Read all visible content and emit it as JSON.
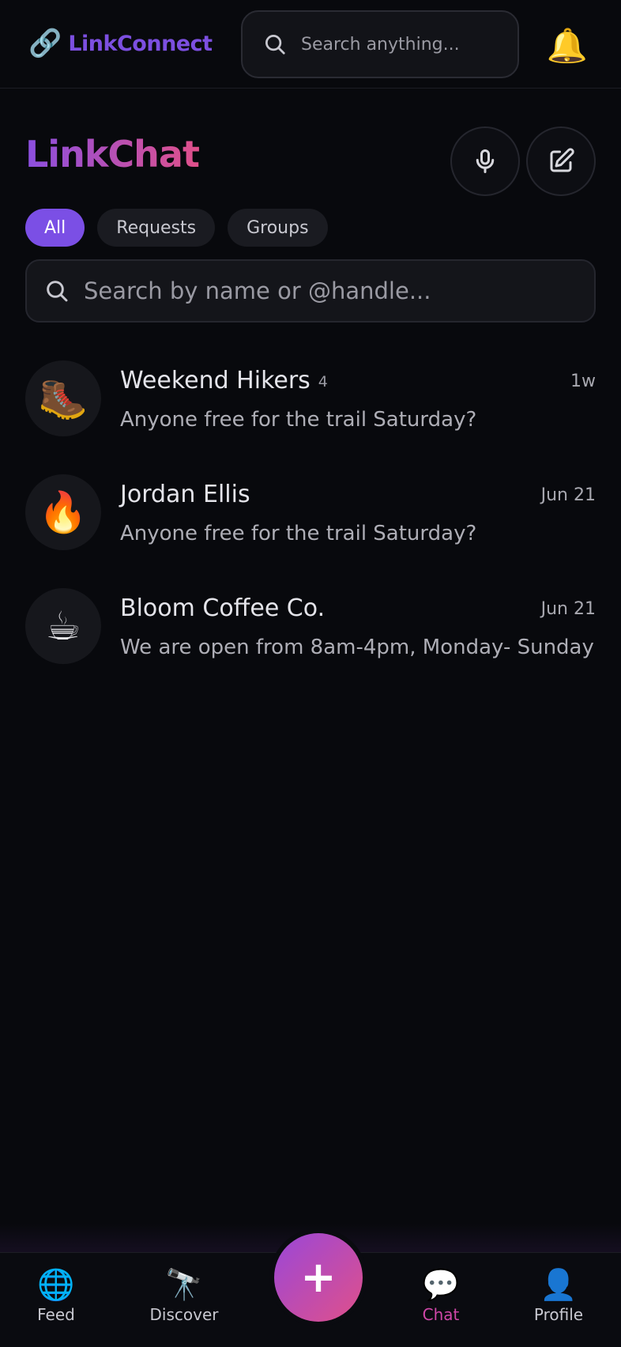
{
  "topbar": {
    "brand_icon": "🔗",
    "brand_name": "LinkConnect",
    "search_placeholder": "Search anything...",
    "bell_icon": "🔔"
  },
  "header": {
    "title": "LinkChat"
  },
  "tabs": [
    {
      "label": "All",
      "active": true
    },
    {
      "label": "Requests",
      "active": false
    },
    {
      "label": "Groups",
      "active": false
    }
  ],
  "list_search": {
    "placeholder": "Search by name or @handle..."
  },
  "chats": [
    {
      "avatar": "🥾",
      "name": "Weekend Hikers",
      "count": "4",
      "time": "1w",
      "preview": "Anyone free for the trail Saturday?"
    },
    {
      "avatar": "🔥",
      "name": "Jordan Ellis",
      "count": "",
      "time": "Jun 21",
      "preview": "Anyone free for the trail Saturday?"
    },
    {
      "avatar": "☕",
      "name": "Bloom Coffee Co.",
      "count": "",
      "time": "Jun 21",
      "preview": "We are open from 8am-4pm, Monday- Sunday"
    }
  ],
  "bottom_nav": {
    "items": [
      {
        "icon": "🌐",
        "label": "Feed"
      },
      {
        "icon": "🔭",
        "label": "Discover"
      },
      {
        "icon": "💬",
        "label": "Chat",
        "active": true
      },
      {
        "icon": "👤",
        "label": "Profile"
      }
    ],
    "fab_label": "+"
  },
  "colors": {
    "accent": "#7b4fe5",
    "gradient_start": "#8b4fe0",
    "gradient_end": "#e0508a",
    "background": "#08090d"
  }
}
